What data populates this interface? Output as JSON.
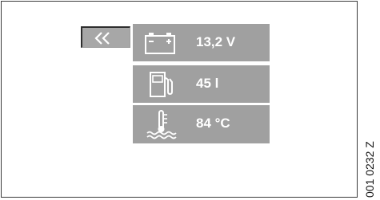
{
  "back_button": {
    "icon": "double-chevron-left-icon"
  },
  "readings": [
    {
      "icon": "battery-icon",
      "value": "13,2 V"
    },
    {
      "icon": "fuel-tank-icon",
      "value": "45 l"
    },
    {
      "icon": "coolant-temperature-icon",
      "value": "84 °C"
    }
  ],
  "reference_code": "001 0232 Z",
  "colors": {
    "panel": "#a0a0a0",
    "button": "#a7a7a7",
    "text": "#ffffff"
  }
}
